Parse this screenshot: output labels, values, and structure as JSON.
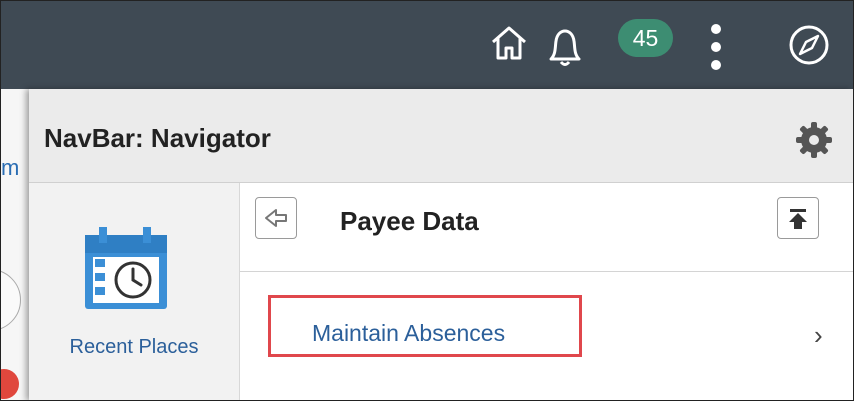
{
  "header": {
    "notification_count": "45",
    "icons": [
      "home-icon",
      "bell-icon",
      "kebab-menu-icon",
      "compass-icon"
    ],
    "bg_color": "#3f4a54",
    "badge_color": "#3d8d72"
  },
  "background_page": {
    "letter": "m"
  },
  "navigator": {
    "title": "NavBar: Navigator",
    "settings_icon": "gear-icon",
    "sidebar": {
      "recent_places_label": "Recent Places",
      "icon": "calendar-clock-icon"
    },
    "folder": {
      "title": "Payee Data",
      "back_icon": "arrow-left-icon",
      "top_icon": "collapse-to-top-icon"
    },
    "items": [
      {
        "label": "Maintain Absences",
        "highlighted": true
      }
    ],
    "link_color": "#2b5f9a",
    "highlight_color": "#e0474c"
  }
}
